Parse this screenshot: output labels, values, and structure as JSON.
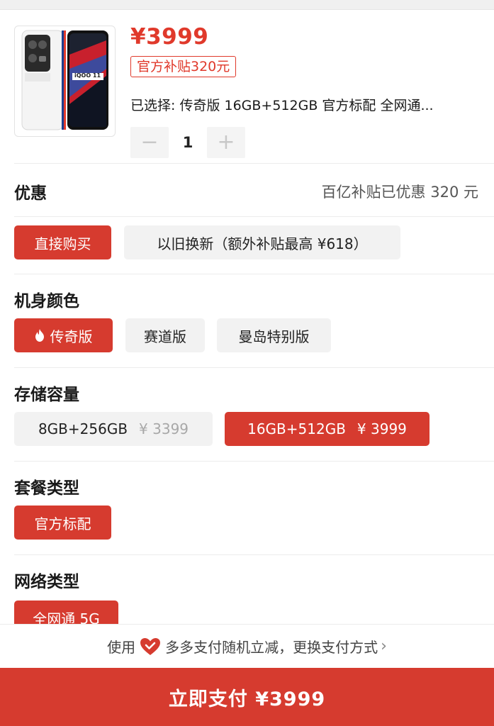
{
  "product": {
    "price": "¥3999",
    "subsidy_tag": "官方补贴320元",
    "selected_text": "已选择: 传奇版 16GB+512GB 官方标配 全网通...",
    "quantity": "1",
    "minus_label": "−",
    "plus_label": "+",
    "phone_badge": "iQOO 11"
  },
  "discount": {
    "label": "优惠",
    "value": "百亿补贴已优惠 320 元"
  },
  "purchase_mode": {
    "options": [
      "直接购买",
      "以旧换新（额外补贴最高 ¥618）"
    ],
    "selected": 0
  },
  "color": {
    "title": "机身颜色",
    "options": [
      "传奇版",
      "赛道版",
      "曼岛特别版"
    ],
    "selected": 0
  },
  "storage": {
    "title": "存储容量",
    "options": [
      {
        "label": "8GB+256GB",
        "price": "¥ 3399"
      },
      {
        "label": "16GB+512GB",
        "price": "¥ 3999"
      }
    ],
    "selected": 1
  },
  "package": {
    "title": "套餐类型",
    "options": [
      "官方标配"
    ]
  },
  "network": {
    "title": "网络类型",
    "options": [
      "全网通 5G"
    ]
  },
  "pay_tip": {
    "prefix": "使用",
    "text": "多多支付随机立减，更换支付方式",
    "chevron": "›"
  },
  "pay_button": "立即支付 ¥3999",
  "colors": {
    "accent": "#d63b2f",
    "price_red": "#e0392b",
    "chip_gray": "#f2f2f2"
  }
}
